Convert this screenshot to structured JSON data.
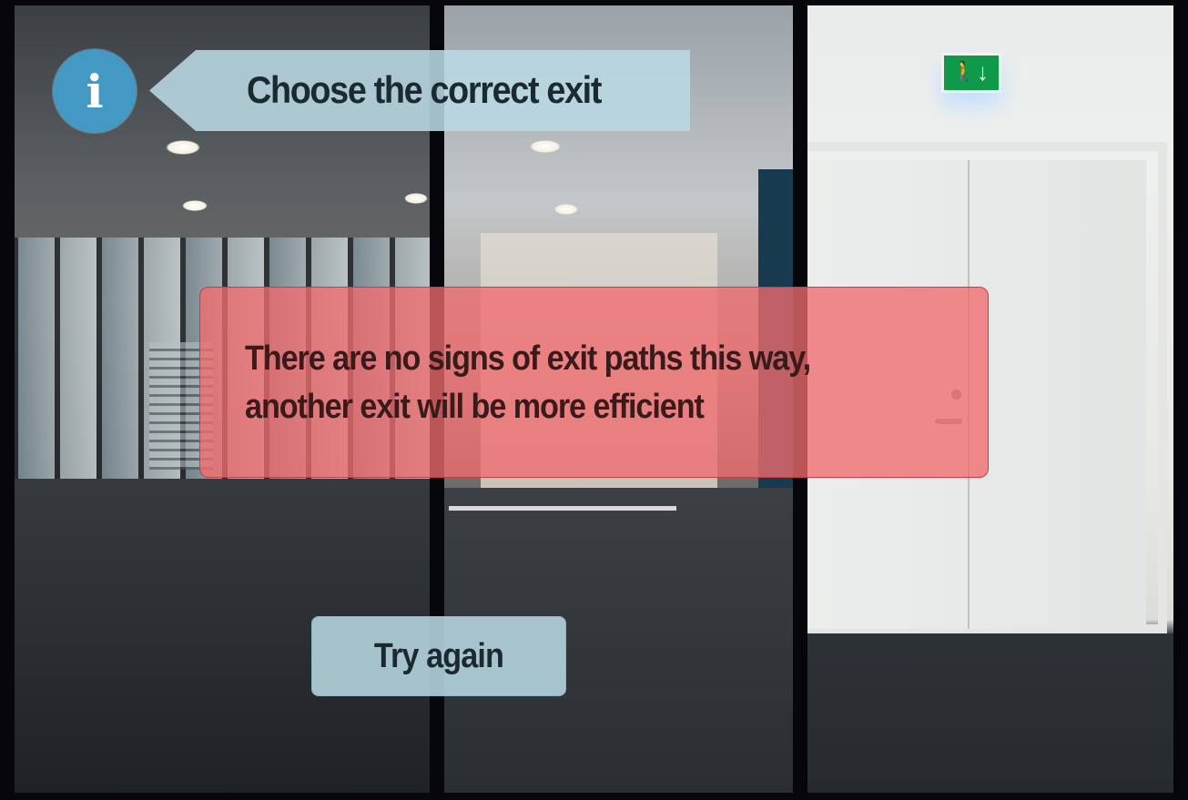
{
  "instruction": {
    "icon": "info-icon",
    "icon_glyph": "i",
    "text": "Choose the correct exit"
  },
  "feedback": {
    "line1": "There are no signs of exit paths this way,",
    "line2": "another exit will be more efficient",
    "color": "#f06c6e"
  },
  "actions": {
    "try_again_label": "Try again"
  },
  "scene": {
    "panels": [
      "left-hallway",
      "middle-corridor",
      "right-door-with-exit-sign"
    ],
    "exit_sign_icon": "emergency-exit-sign-icon"
  },
  "colors": {
    "info_blue": "#4499c4",
    "banner_blue": "#b9d8e2",
    "exit_green": "#0f9a4a"
  }
}
